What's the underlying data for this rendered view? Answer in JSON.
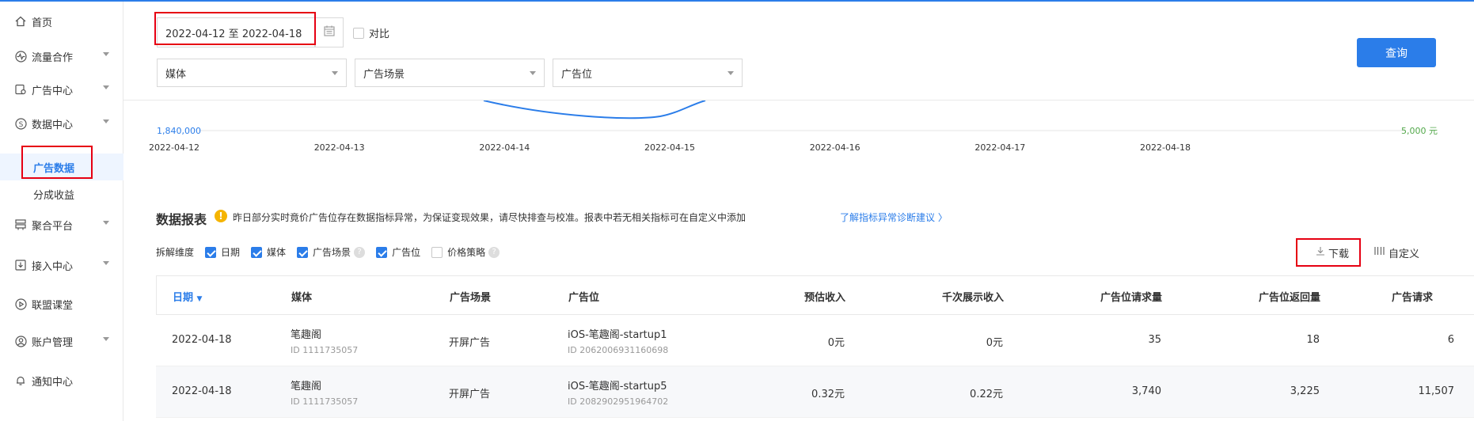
{
  "sidebar": {
    "items": [
      {
        "label": "首页",
        "icon": "home-icon"
      },
      {
        "label": "流量合作",
        "icon": "pulse-icon"
      },
      {
        "label": "广告中心",
        "icon": "ad-icon"
      },
      {
        "label": "数据中心",
        "icon": "dollar-circle-icon"
      },
      {
        "label": "聚合平台",
        "icon": "server-icon"
      },
      {
        "label": "接入中心",
        "icon": "download-box-icon"
      },
      {
        "label": "联盟课堂",
        "icon": "play-circle-icon"
      },
      {
        "label": "账户管理",
        "icon": "user-circle-icon"
      },
      {
        "label": "通知中心",
        "icon": "bell-icon"
      }
    ],
    "sub_items": [
      {
        "label": "广告数据"
      },
      {
        "label": "分成收益"
      }
    ]
  },
  "filters": {
    "date_range": "2022-04-12 至 2022-04-18",
    "compare_label": "对比",
    "media_placeholder": "媒体",
    "scene_placeholder": "广告场景",
    "slot_placeholder": "广告位",
    "query_label": "查询"
  },
  "chart": {
    "left_axis_label": "1,840,000",
    "right_axis_label": "5,000 元",
    "dates": [
      "2022-04-12",
      "2022-04-13",
      "2022-04-14",
      "2022-04-15",
      "2022-04-16",
      "2022-04-17",
      "2022-04-18"
    ],
    "line_color": "#2b7de9",
    "right_axis_color": "#52a84a"
  },
  "report": {
    "title": "数据报表",
    "notice": "昨日部分实时竟价广告位存在数据指标异常，为保证变现效果，请尽快排查与校准。报表中若无相关指标可在自定义中添加",
    "notice_link": "了解指标异常诊断建议 〉",
    "dims_label": "拆解维度",
    "dims": [
      {
        "label": "日期",
        "checked": true
      },
      {
        "label": "媒体",
        "checked": true
      },
      {
        "label": "广告场景",
        "checked": true
      },
      {
        "label": "广告位",
        "checked": true
      },
      {
        "label": "价格策略",
        "checked": false
      }
    ],
    "download_label": "下载",
    "custom_label": "自定义"
  },
  "table": {
    "columns": [
      "日期",
      "媒体",
      "广告场景",
      "广告位",
      "预估收入",
      "千次展示收入",
      "广告位请求量",
      "广告位返回量",
      "广告请求"
    ],
    "rows": [
      {
        "date": "2022-04-18",
        "media": "笔趣阁",
        "media_id": "ID 1111735057",
        "scene": "开屏广告",
        "slot": "iOS-笔趣阁-startup1",
        "slot_id": "ID 2062006931160698",
        "revenue": "0元",
        "ecpm": "0元",
        "requests": "35",
        "returns": "18",
        "ad_requests": "6"
      },
      {
        "date": "2022-04-18",
        "media": "笔趣阁",
        "media_id": "ID 1111735057",
        "scene": "开屏广告",
        "slot": "iOS-笔趣阁-startup5",
        "slot_id": "ID 2082902951964702",
        "revenue": "0.32元",
        "ecpm": "0.22元",
        "requests": "3,740",
        "returns": "3,225",
        "ad_requests": "11,507"
      }
    ]
  }
}
